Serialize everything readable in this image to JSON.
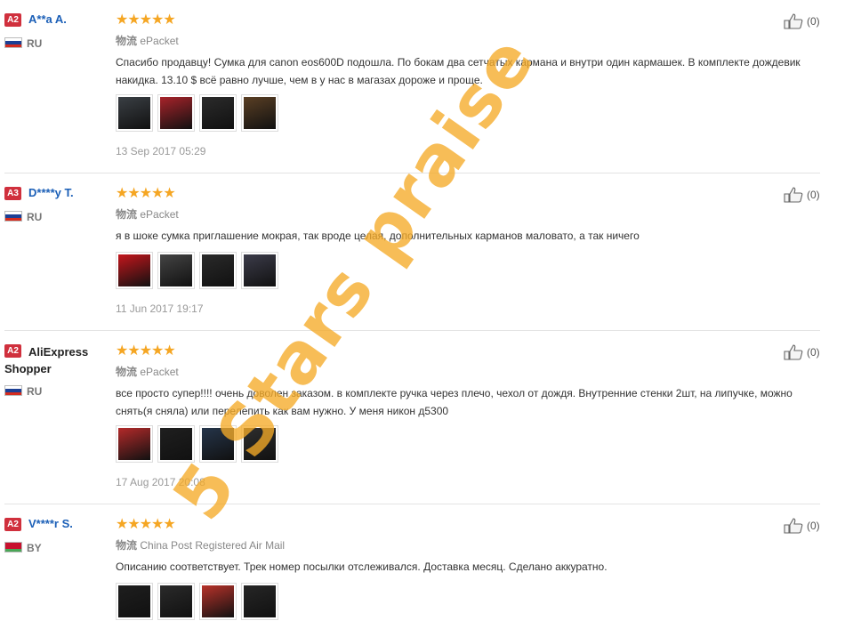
{
  "reviews": [
    {
      "level": "A2",
      "name": "A**a A.",
      "country": "RU",
      "flag": [
        "#ffffff",
        "#1c3f94",
        "#d52b1e"
      ],
      "stars": "★★★★★",
      "ship_prefix": "物流",
      "shipping": "ePacket",
      "text": "Спасибо продавцу! Сумка для canon eos600D подошла. По бокам два сетчатых кармана и внутри один кармашек. В комплекте дождевик накидка. 13.10 $ всё равно лучше, чем в у нас в магазах дороже и проще.",
      "photos": [
        "#3a3f44",
        "#a8232a",
        "#2b2b2b",
        "#5a3f24"
      ],
      "date": "13 Sep 2017 05:29",
      "helpful": "(0)"
    },
    {
      "level": "A3",
      "name": "D****y T.",
      "country": "RU",
      "flag": [
        "#ffffff",
        "#1c3f94",
        "#d52b1e"
      ],
      "stars": "★★★★★",
      "ship_prefix": "物流",
      "shipping": "ePacket",
      "text": "я в шоке сумка приглашение мокрая, так вроде целая, дополнительных карманов маловато, а так ничего",
      "photos": [
        "#c4161c",
        "#444444",
        "#2a2a2a",
        "#3c3c4a"
      ],
      "date": "11 Jun 2017 19:17",
      "helpful": "(0)"
    },
    {
      "level": "A2",
      "name": "AliExpress Shopper",
      "country": "RU",
      "flag": [
        "#ffffff",
        "#1c3f94",
        "#d52b1e"
      ],
      "stars": "★★★★★",
      "ship_prefix": "物流",
      "shipping": "ePacket",
      "text": "все просто супер!!!! очень доволен заказом. в комплекте ручка через плечо, чехол от дождя. Внутренние стенки 2шт, на липучке, можно снять(я  сняла) или перелепить как вам нужно. У меня никон д5300",
      "photos": [
        "#b42a2a",
        "#1f1f1f",
        "#25354a",
        "#2e2e2e"
      ],
      "date": "17 Aug 2017 20:08",
      "helpful": "(0)"
    },
    {
      "level": "A2",
      "name": "V****r S.",
      "country": "BY",
      "flag": [
        "#c8102e",
        "#c8102e",
        "#4aa657"
      ],
      "stars": "★★★★★",
      "ship_prefix": "物流",
      "shipping": "China Post Registered Air Mail",
      "text": "Описанию соответствует. Трек номер посылки отслеживался. Доставка месяц. Сделано аккуратно.",
      "photos": [
        "#1e1e1e",
        "#2a2a2a",
        "#b8322a",
        "#262626"
      ],
      "date": "",
      "helpful": "(0)"
    }
  ],
  "watermark": "5 Stars praise"
}
